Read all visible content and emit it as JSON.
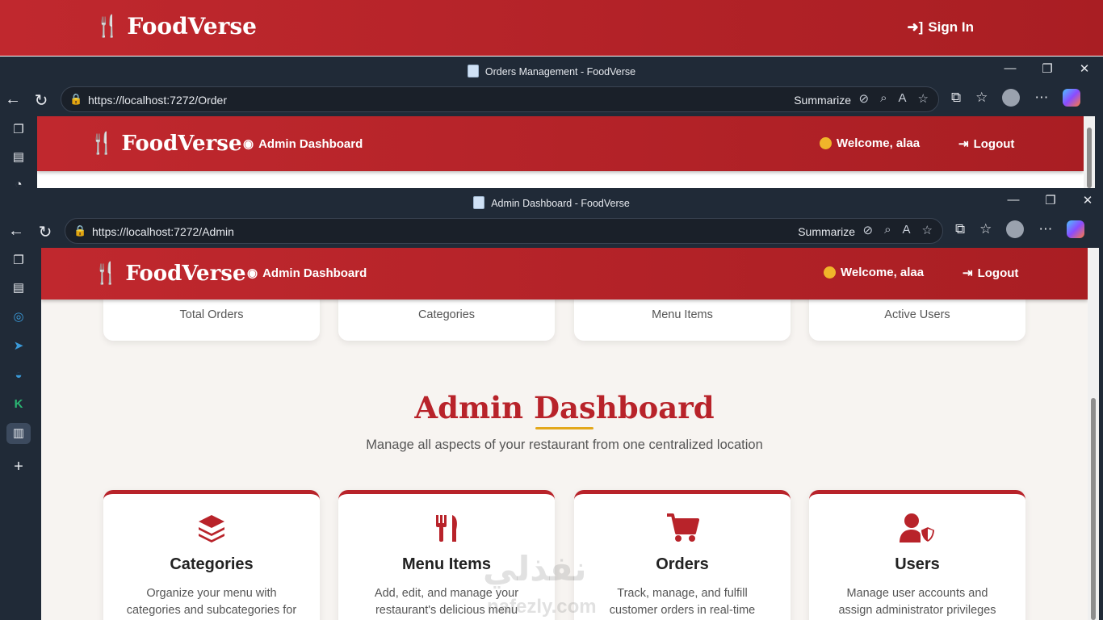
{
  "site": {
    "brand": "FoodVerse",
    "signin": "Sign In"
  },
  "window1": {
    "title": "Orders Management - FoodVerse",
    "url": "https://localhost:7272/Order",
    "summarize": "Summarize"
  },
  "window2": {
    "title": "Admin Dashboard - FoodVerse",
    "url": "https://localhost:7272/Admin",
    "summarize": "Summarize"
  },
  "app": {
    "brand": "FoodVerse",
    "admin_link": "Admin Dashboard",
    "welcome": "Welcome, alaa",
    "logout": "Logout"
  },
  "stats": [
    "Total Orders",
    "Categories",
    "Menu Items",
    "Active Users"
  ],
  "dashboard": {
    "title": "Admin Dashboard",
    "subtitle": "Manage all aspects of your restaurant from one centralized location"
  },
  "features": [
    {
      "icon": "layers-icon",
      "name": "Categories",
      "desc": "Organize your menu with categories and subcategories for better navigation"
    },
    {
      "icon": "utensils-icon",
      "name": "Menu Items",
      "desc": "Add, edit, and manage your restaurant's delicious menu offerings"
    },
    {
      "icon": "cart-icon",
      "name": "Orders",
      "desc": "Track, manage, and fulfill customer orders in real-time"
    },
    {
      "icon": "user-shield-icon",
      "name": "Users",
      "desc": "Manage user accounts and assign administrator privileges"
    }
  ],
  "watermark": {
    "arabic": "نفذلي",
    "latin": "nafezly.com"
  },
  "colors": {
    "brand_red": "#b8232a",
    "accent_gold": "#e3a81c",
    "chrome": "#202a37"
  }
}
